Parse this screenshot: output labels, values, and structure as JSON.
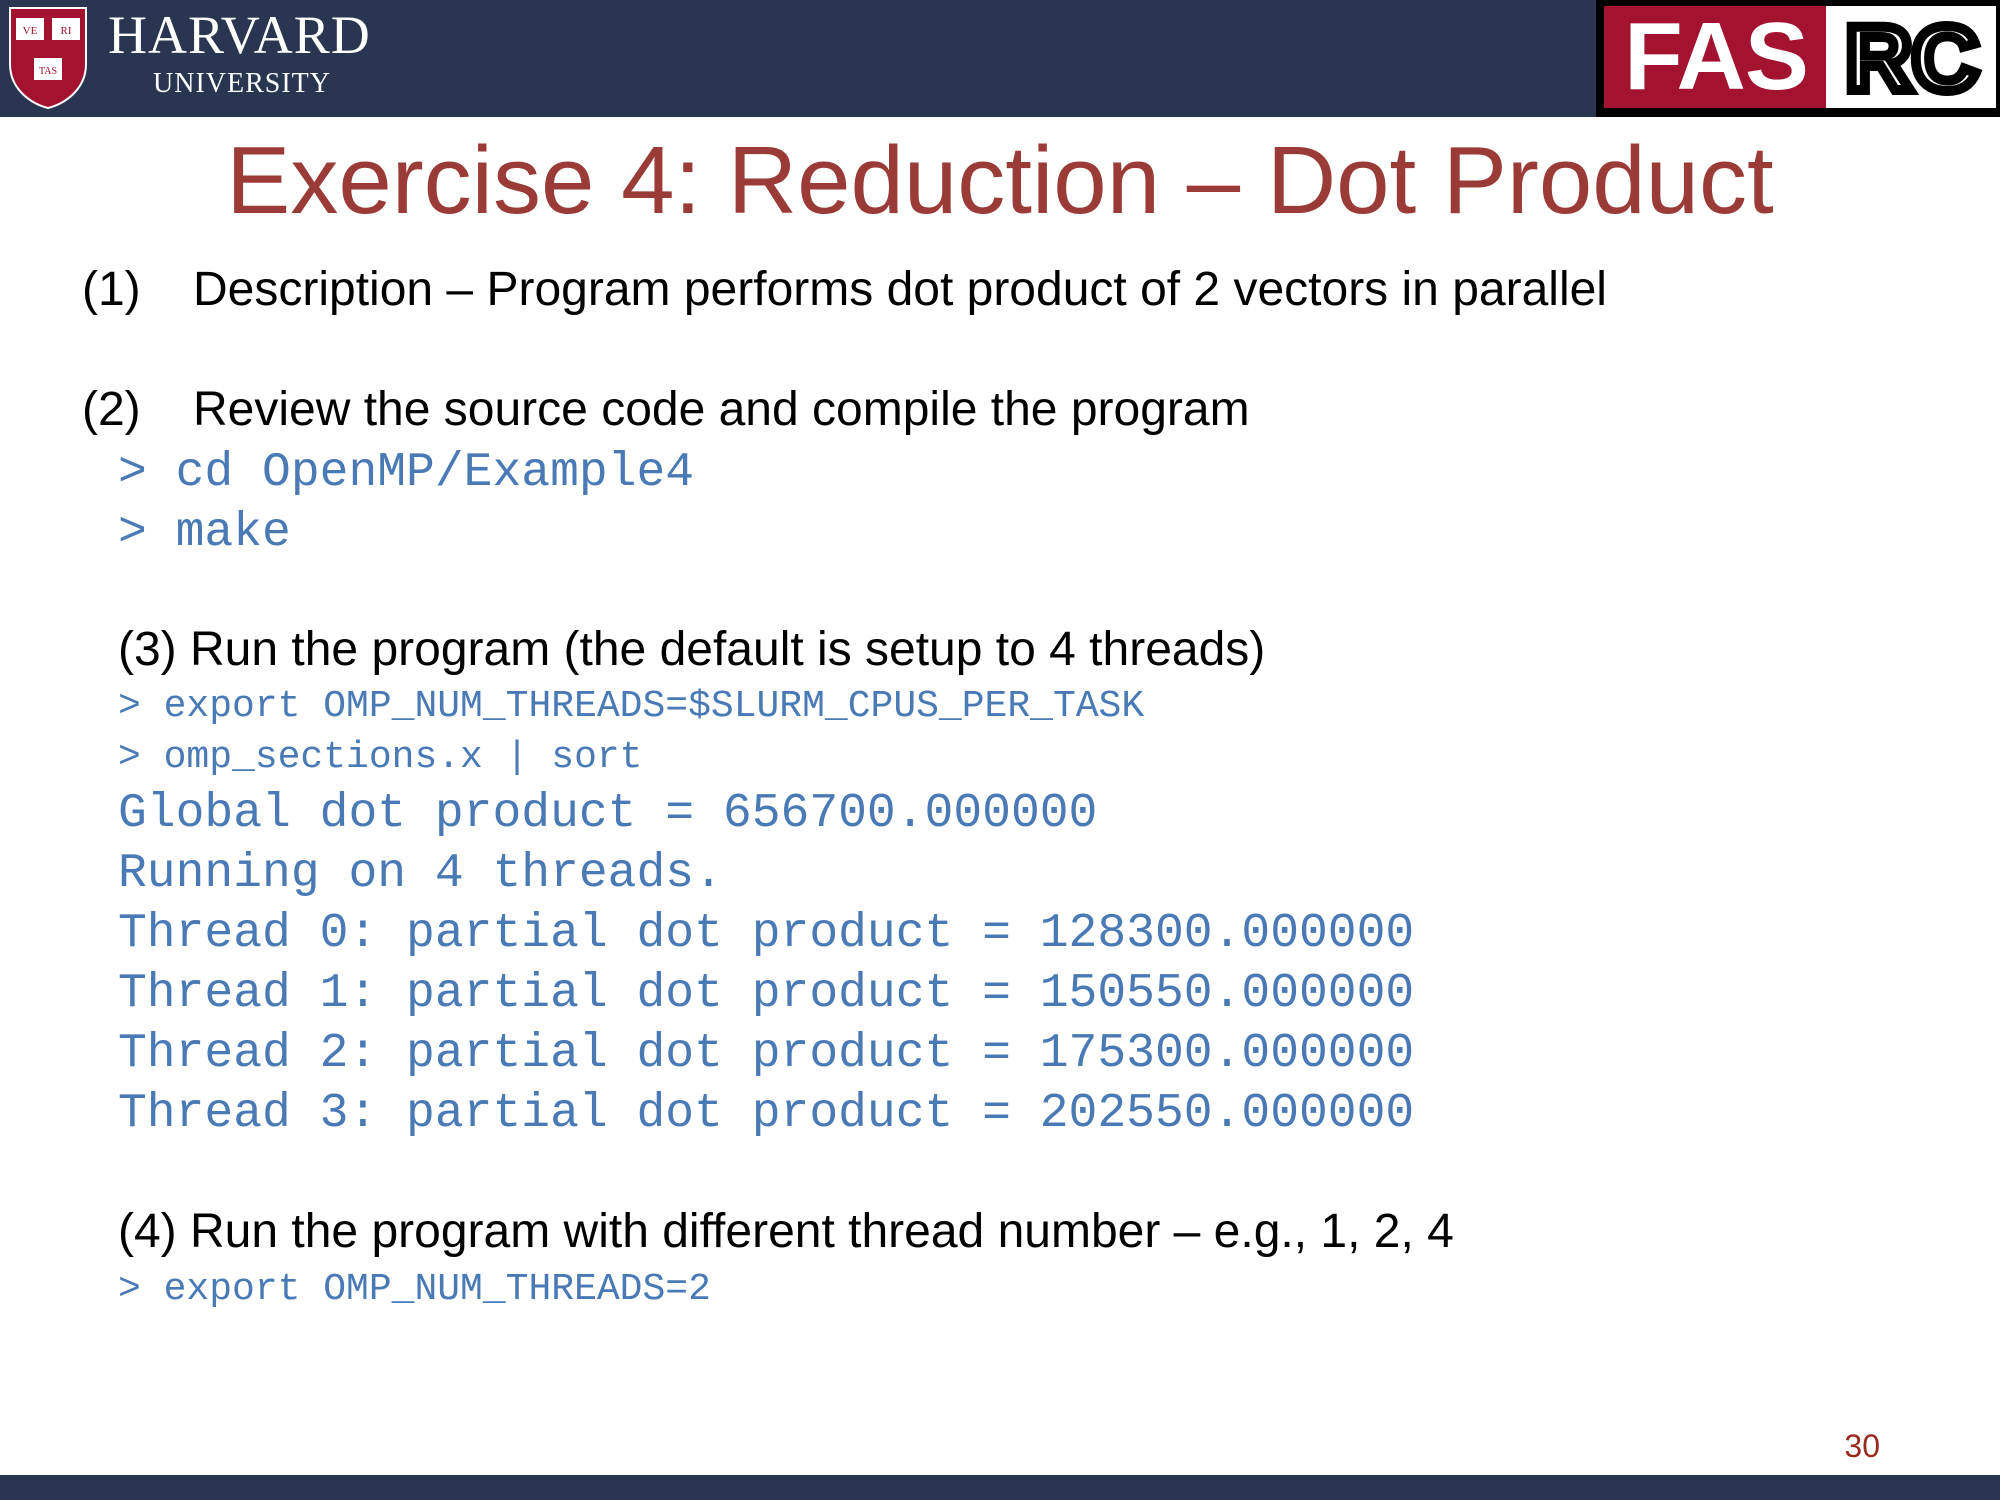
{
  "header": {
    "university_name": "HARVARD",
    "university_sub": "UNIVERSITY",
    "shield_text": [
      "VE",
      "RI",
      "TAS"
    ],
    "fasrc_red_text": "FAS",
    "fasrc_black_text": "RC",
    "bar_color": "#2a3551"
  },
  "slide": {
    "title": "Exercise 4: Reduction – Dot Product",
    "steps": [
      {
        "number": "(1)",
        "text": "Description – Program performs dot product of 2 vectors in parallel"
      },
      {
        "number": "(2)",
        "text": "Review the source code and compile the program"
      },
      {
        "text": "(3) Run the program (the default is setup to 4 threads)"
      },
      {
        "text": "(4) Run the program with different thread number – e.g., 1, 2, 4"
      }
    ],
    "code_step2": [
      "> cd OpenMP/Example4",
      "> make"
    ],
    "code_step3_commands": [
      "> export OMP_NUM_THREADS=$SLURM_CPUS_PER_TASK",
      "> omp_sections.x | sort"
    ],
    "code_step3_output": [
      "Global dot product = 656700.000000",
      "Running on 4 threads.",
      "Thread 0: partial dot product = 128300.000000",
      "Thread 1: partial dot product = 150550.000000",
      "Thread 2: partial dot product = 175300.000000",
      "Thread 3: partial dot product = 202550.000000"
    ],
    "code_step4": [
      "> export OMP_NUM_THREADS=2"
    ],
    "page_number": "30"
  },
  "colors": {
    "title": "#9b3b38",
    "code": "#4a7ab5",
    "fasrc_red": "#a3122f"
  }
}
